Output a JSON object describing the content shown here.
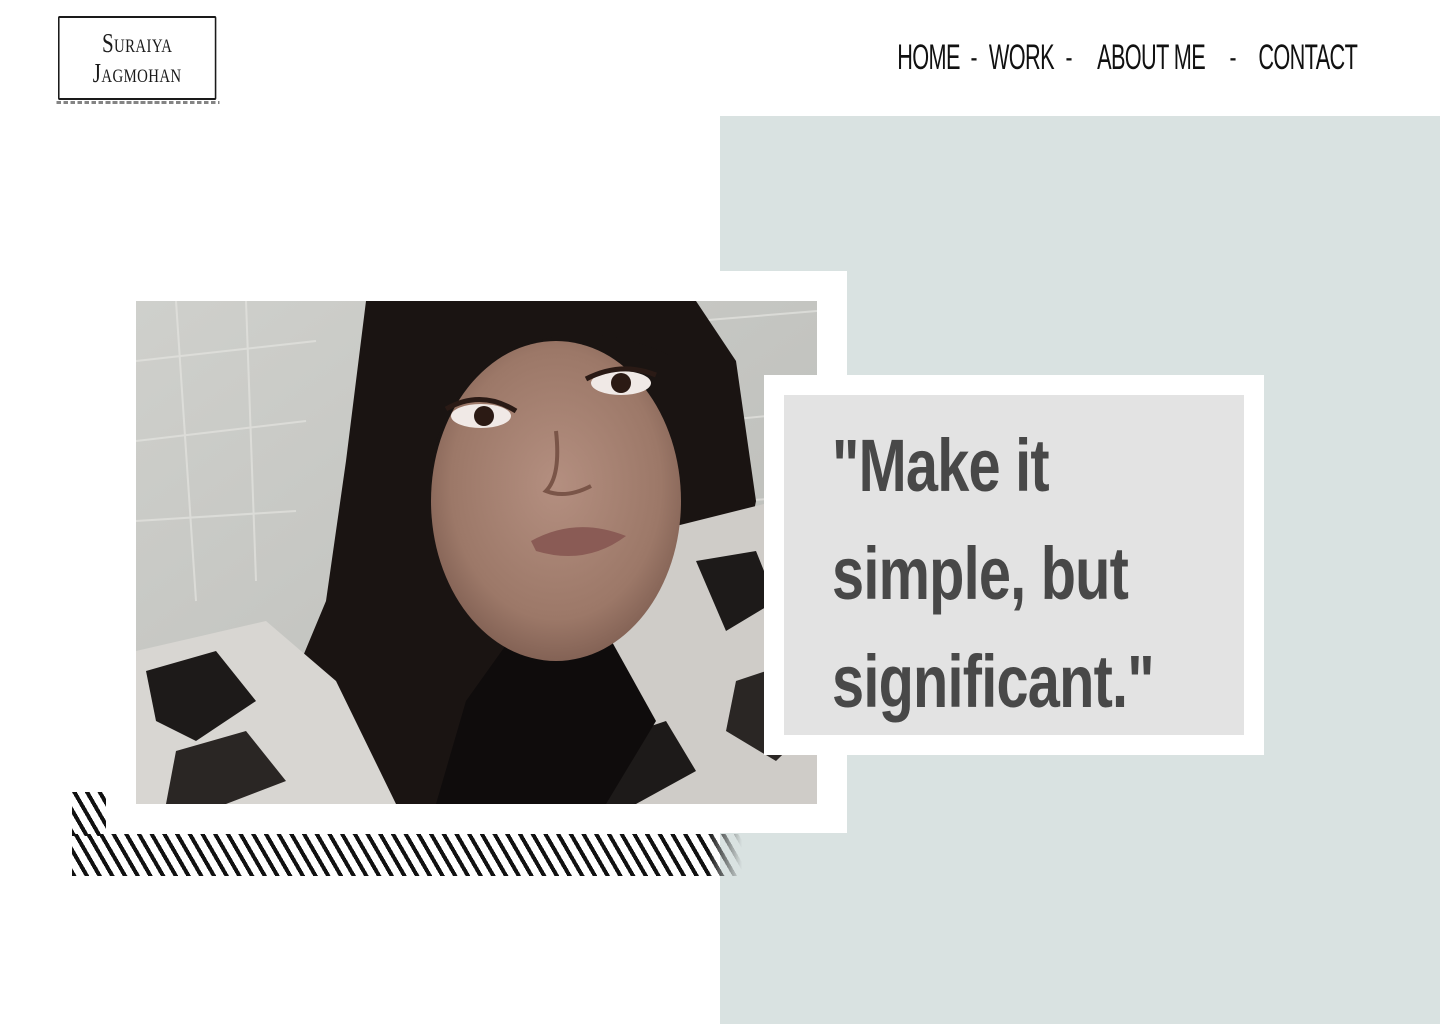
{
  "brand": {
    "line1": "Suraiya",
    "line2": "Jagmohan"
  },
  "nav": {
    "items": [
      "HOME",
      "WORK",
      "ABOUT ME",
      "CONTACT"
    ],
    "separator": "-"
  },
  "hero": {
    "photo_alt": "Portrait photo",
    "quote": "\"Make it simple, but significant.\""
  },
  "colors": {
    "panel": "#d9e2e1",
    "quote_box": "#e3e3e3",
    "quote_text": "#484848"
  }
}
